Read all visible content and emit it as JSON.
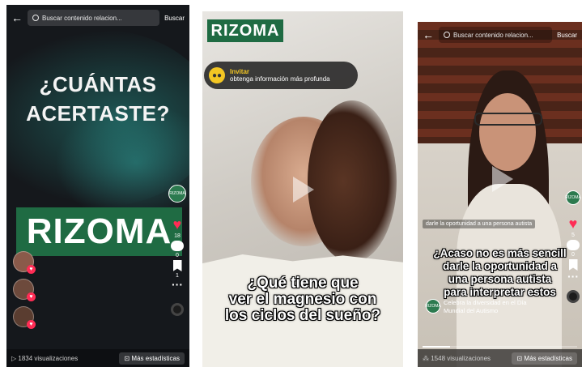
{
  "panel1": {
    "search_placeholder": "Buscar contenido relacion...",
    "search_button": "Buscar",
    "headline_line1": "¿CUÁNTAS",
    "headline_line2": "ACERTASTE?",
    "brand": "RIZOMA",
    "counts": {
      "likes": "18",
      "comments": "0",
      "saves": "1"
    },
    "views": "1834 visualizaciones",
    "stats_button": "Más estadísticas"
  },
  "panel2": {
    "brand": "RIZOMA",
    "invite_title": "Invitar",
    "invite_subtitle": "obtenga información más profunda",
    "subtitle_line1": "¿Qué tiene que",
    "subtitle_line2": "ver el magnesio con",
    "subtitle_line3": "los ciclos del sueño?"
  },
  "panel3": {
    "search_placeholder": "Buscar contenido relacion...",
    "search_button": "Buscar",
    "chip": "darle la oportunidad a una persona autista",
    "subtitle_line1": "¿Acaso no es más sencill",
    "subtitle_line2": "darle la oportunidad a",
    "subtitle_line3": "una persona autista",
    "subtitle_line4": "para interpretar estos",
    "promo_line1": "Celebra la diversidad en el Día",
    "promo_line2": "Mundial del Autismo",
    "counts": {
      "likes": "5",
      "comments": "0"
    },
    "views": "1548 visualizaciones",
    "stats_button": "Más estadísticas",
    "progress": 0.18
  },
  "colors": {
    "brand_green": "#1f6b43",
    "like_red": "#ff2c55",
    "invite_yellow": "#f3c623"
  }
}
